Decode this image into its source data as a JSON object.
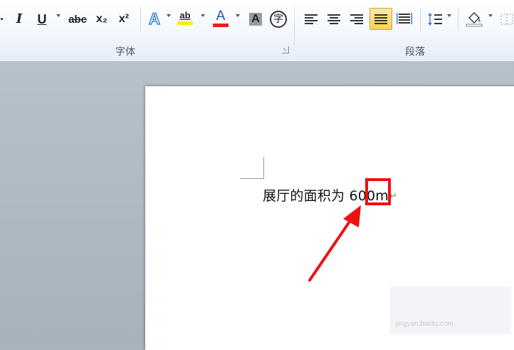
{
  "window": {
    "ribbon": {
      "font_group": {
        "label": "字体",
        "buttons": [
          {
            "name": "italic",
            "glyph": "I"
          },
          {
            "name": "underline",
            "glyph": "U"
          },
          {
            "name": "strikethrough",
            "glyph": "abc"
          },
          {
            "name": "subscript",
            "glyph": "x₂"
          },
          {
            "name": "superscript",
            "glyph": "x²"
          },
          {
            "name": "text-effects",
            "glyph": "A"
          },
          {
            "name": "highlight",
            "glyph": "ab"
          },
          {
            "name": "font-color",
            "glyph": "A"
          },
          {
            "name": "character-shading",
            "glyph": "A"
          },
          {
            "name": "enclose-characters",
            "glyph": "字"
          }
        ]
      },
      "paragraph_group": {
        "label": "段落",
        "active_button": "justify"
      }
    },
    "colors": {
      "accent_highlight": "#f5d35a",
      "font_color_bar": "#e8201a",
      "highlight_bar": "#ffee00",
      "annotation_red": "#ee1111"
    }
  },
  "document": {
    "text": "展厅的面积为 600m",
    "paragraph_mark": "↵",
    "watermark": "jingyan.baidu.com"
  }
}
